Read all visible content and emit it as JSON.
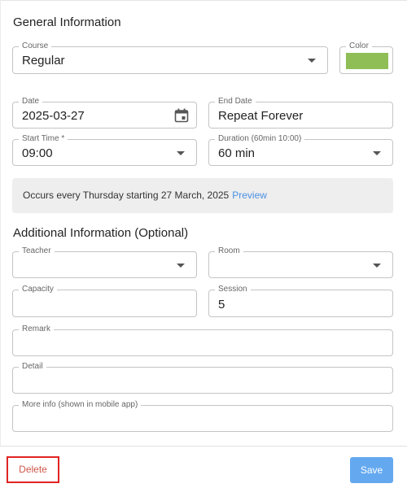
{
  "general": {
    "title": "General Information",
    "course": {
      "label": "Course",
      "value": "Regular"
    },
    "color": {
      "label": "Color",
      "value": "#8fbe57"
    },
    "date": {
      "label": "Date",
      "value": "2025-03-27"
    },
    "end_date": {
      "label": "End Date",
      "value": "Repeat Forever"
    },
    "start_time": {
      "label": "Start Time *",
      "value": "09:00"
    },
    "duration": {
      "label": "Duration (60min 10:00)",
      "value": "60 min"
    },
    "summary": {
      "text": "Occurs every Thursday starting 27 March, 2025",
      "link": "Preview"
    }
  },
  "additional": {
    "title": "Additional Information (Optional)",
    "teacher": {
      "label": "Teacher",
      "value": ""
    },
    "room": {
      "label": "Room",
      "value": ""
    },
    "capacity": {
      "label": "Capacity",
      "value": ""
    },
    "session": {
      "label": "Session",
      "value": "5"
    },
    "remark": {
      "label": "Remark",
      "value": ""
    },
    "detail": {
      "label": "Detail",
      "value": ""
    },
    "more_info": {
      "label": "More info (shown in mobile app)",
      "value": ""
    }
  },
  "footer": {
    "delete_label": "Delete",
    "save_label": "Save"
  },
  "icons": {
    "date_picker": "calendar-icon",
    "dropdown": "chevron-down-icon"
  }
}
